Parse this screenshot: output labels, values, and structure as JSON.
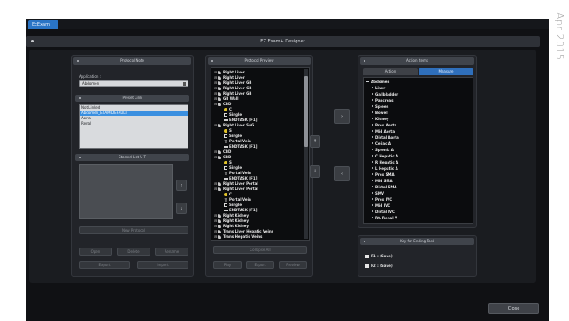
{
  "app_tab": "EcExam",
  "date_stamp": "Apr 2015",
  "window_title": "EZ Exam+ Designer",
  "protocol_note": {
    "header": "Protocol Note",
    "application_label": "Application :",
    "application_value": "Abdomen",
    "preset_header": "Preset Link",
    "preset_items": [
      "Not Linked",
      "Abdomen_EXAM-DEFAULT",
      "Aorta",
      "Renal"
    ],
    "preset_selected_index": 1,
    "starred_header": "Starred List  U  T",
    "new_protocol": "New Protocol",
    "buttons_row1": [
      "Open",
      "Delete",
      "Rename"
    ],
    "buttons_row2": [
      "Export",
      "Import"
    ]
  },
  "protocol_preview": {
    "header": "Protocol Preview",
    "rows": [
      {
        "indent": 0,
        "expander": "⊟",
        "icon": "organ",
        "text": "Right Liver"
      },
      {
        "indent": 0,
        "expander": "⊟",
        "icon": "organ",
        "text": "Right Liver"
      },
      {
        "indent": 0,
        "expander": "⊟",
        "icon": "organ",
        "text": "Right Liver GB"
      },
      {
        "indent": 0,
        "expander": "⊟",
        "icon": "organ",
        "text": "Right Liver GB"
      },
      {
        "indent": 0,
        "expander": "⊟",
        "icon": "organ",
        "text": "Right Liver GB"
      },
      {
        "indent": 0,
        "expander": "⊟",
        "icon": "organ",
        "text": "GB Wall"
      },
      {
        "indent": 0,
        "expander": "⊟",
        "icon": "organ",
        "text": "CBD"
      },
      {
        "indent": 1,
        "expander": "",
        "icon": "c",
        "text": "C"
      },
      {
        "indent": 1,
        "expander": "",
        "icon": "box",
        "text": "Single"
      },
      {
        "indent": 1,
        "expander": "",
        "icon": "ruler",
        "text": "ENDTASK [F1]"
      },
      {
        "indent": 0,
        "expander": "⊟",
        "icon": "organ",
        "text": "Right Liver SAG"
      },
      {
        "indent": 1,
        "expander": "",
        "icon": "c",
        "text": "S"
      },
      {
        "indent": 1,
        "expander": "",
        "icon": "box",
        "text": "Single"
      },
      {
        "indent": 1,
        "expander": "",
        "icon": "t",
        "text": "Portal Vein"
      },
      {
        "indent": 1,
        "expander": "",
        "icon": "ruler",
        "text": "ENDTASK [F1]"
      },
      {
        "indent": 0,
        "expander": "⊟",
        "icon": "organ",
        "text": "CBD"
      },
      {
        "indent": 0,
        "expander": "⊟",
        "icon": "organ",
        "text": "CBD"
      },
      {
        "indent": 1,
        "expander": "",
        "icon": "c",
        "text": "S"
      },
      {
        "indent": 1,
        "expander": "",
        "icon": "box",
        "text": "Single"
      },
      {
        "indent": 1,
        "expander": "",
        "icon": "t",
        "text": "Portal Vein"
      },
      {
        "indent": 1,
        "expander": "",
        "icon": "ruler",
        "text": "ENDTASK [F1]"
      },
      {
        "indent": 0,
        "expander": "⊟",
        "icon": "organ",
        "text": "Right Liver Portal"
      },
      {
        "indent": 0,
        "expander": "⊟",
        "icon": "organ",
        "text": "Right Liver Portal"
      },
      {
        "indent": 1,
        "expander": "",
        "icon": "c",
        "text": "C"
      },
      {
        "indent": 1,
        "expander": "",
        "icon": "t",
        "text": "Portal Vein"
      },
      {
        "indent": 1,
        "expander": "",
        "icon": "box",
        "text": "Single"
      },
      {
        "indent": 1,
        "expander": "",
        "icon": "ruler",
        "text": "ENDTASK [F1]"
      },
      {
        "indent": 0,
        "expander": "⊟",
        "icon": "organ",
        "text": "Right Kidney"
      },
      {
        "indent": 0,
        "expander": "⊟",
        "icon": "organ",
        "text": "Right Kidney"
      },
      {
        "indent": 0,
        "expander": "⊟",
        "icon": "organ",
        "text": "Right Kidney"
      },
      {
        "indent": 0,
        "expander": "⊟",
        "icon": "organ",
        "text": "Trans Liver Hepatic Veins"
      },
      {
        "indent": 0,
        "expander": "⊟",
        "icon": "organ",
        "text": "Trans Hepatic Veins"
      }
    ],
    "collapse_all": "Collapse All",
    "buttons": [
      "Play",
      "Export",
      "Preview"
    ],
    "side_up": "↑",
    "side_down": "↓"
  },
  "transfer": {
    "add": "»",
    "remove": "«"
  },
  "action_items": {
    "header": "Action Items",
    "tabs": [
      "Action",
      "Measure"
    ],
    "active_tab": 1,
    "root": "Abdomen",
    "items": [
      "Liver",
      "Gallbladder",
      "Pancreas",
      "Spleen",
      "Bowel",
      "Kidney",
      "Prox Aorta",
      "Mid Aorta",
      "Distal Aorta",
      "Celiac A",
      "Splenic A",
      "C Hepatic A",
      "R Hepatic A",
      "L Hepatic A",
      "Prox SMA",
      "Mid SMA",
      "Distal SMA",
      "SMV",
      "Prox IVC",
      "Mid IVC",
      "Distal IVC",
      "Rt. Renal V"
    ]
  },
  "ending_task": {
    "header": "Key for Ending Task",
    "items": [
      "P1 : (Save)",
      "P2 : (Save)"
    ]
  },
  "close": "Close"
}
